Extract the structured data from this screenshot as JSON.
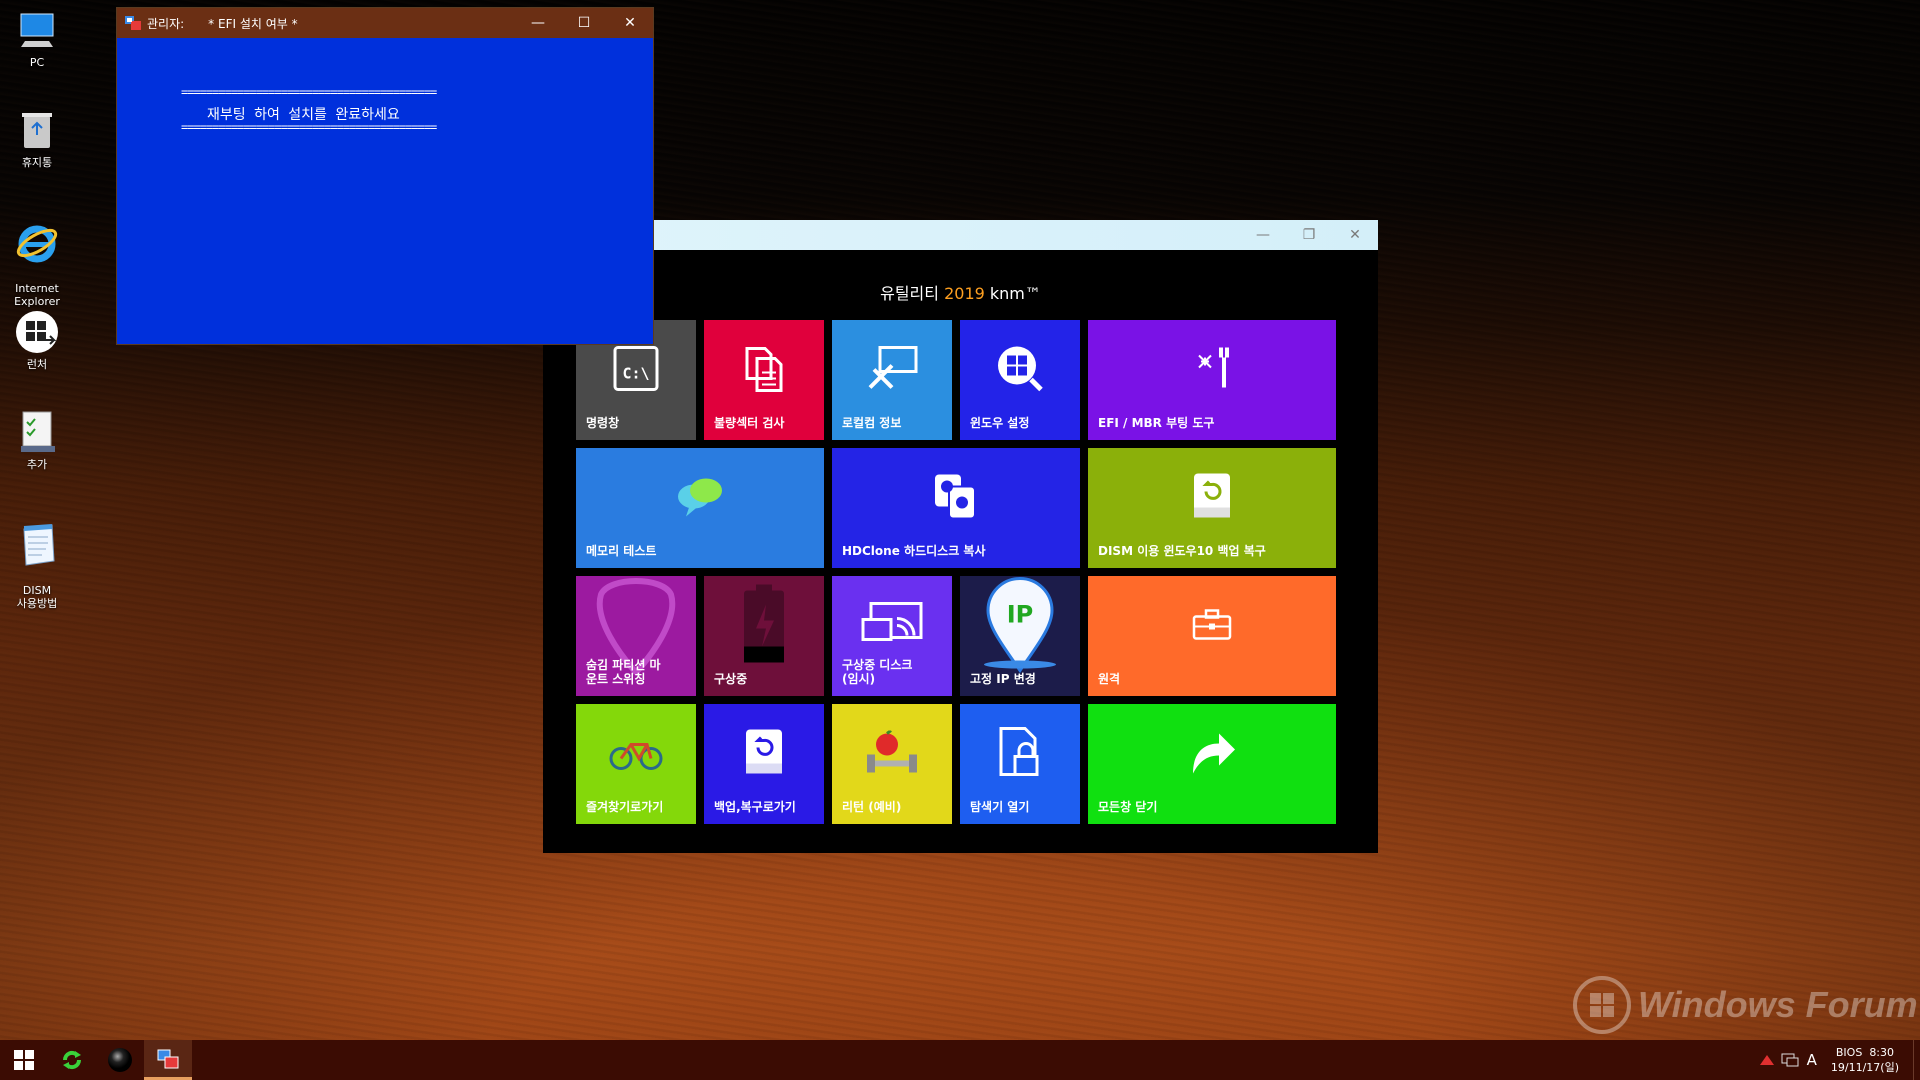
{
  "desktop": {
    "icons": [
      {
        "label": "PC",
        "icon": "computer-icon"
      },
      {
        "label": "휴지통",
        "icon": "recycle-bin-icon"
      },
      {
        "label": "Internet\nExplorer",
        "icon": "internet-explorer-icon"
      },
      {
        "label": "런처",
        "icon": "launcher-icon"
      },
      {
        "label": "추가",
        "icon": "add-checklist-icon"
      },
      {
        "label": "DISM\n사용방법",
        "icon": "notepad-icon"
      }
    ]
  },
  "console": {
    "title_prefix": "관리자:",
    "title": "* EFI 설치 여부 *",
    "separator": "=========================================",
    "message": "재부팅 하여 설치를 완료하세요",
    "controls": {
      "minimize": "—",
      "maximize": "☐",
      "close": "✕"
    }
  },
  "utility": {
    "title_main": "유틸리티 ",
    "title_year": "2019",
    "title_brand": " knm™",
    "controls": {
      "minimize": "—",
      "restore": "❐",
      "close": "✕"
    },
    "tiles": [
      {
        "label": "명령창",
        "color": "#4a4a4a",
        "icon": "command-prompt-icon"
      },
      {
        "label": "불량섹터 검사",
        "color": "#e0003c",
        "icon": "documents-icon"
      },
      {
        "label": "로컬컴 정보",
        "color": "#2b8fe0",
        "icon": "tools-monitor-icon"
      },
      {
        "label": "윈도우 설정",
        "color": "#2323e8",
        "icon": "windows-search-icon"
      },
      {
        "label": "EFI / MBR 부팅 도구",
        "color": "#7a12e6",
        "icon": "wrench-sparkle-icon"
      },
      {
        "label": "메모리 테스트",
        "color": "#2a7ce0",
        "icon": "chat-bubbles-icon"
      },
      {
        "label": "HDClone 하드디스크 복사",
        "color": "#2424e6",
        "icon": "disk-clone-icon"
      },
      {
        "label": "DISM 이용 윈도우10 백업 복구",
        "color": "#8bb00a",
        "icon": "drive-restore-icon"
      },
      {
        "label": "숨김 파티션 마\n운트 스위칭",
        "color": "#9c1aa0",
        "icon": "guitar-pick-icon"
      },
      {
        "label": "구상중",
        "color": "#6e0f3a",
        "icon": "battery-icon"
      },
      {
        "label": "구상중 디스크\n(임시)",
        "color": "#6a30f0",
        "icon": "cast-screen-icon"
      },
      {
        "label": "고정 IP 변경",
        "color": "#1c1c4a",
        "icon": "ip-pin-icon"
      },
      {
        "label": "원격",
        "color": "#ff6a2a",
        "icon": "briefcase-icon"
      },
      {
        "label": "즐겨찾기로가기",
        "color": "#84d80a",
        "icon": "bicycle-icon"
      },
      {
        "label": "백업,복구로가기",
        "color": "#2a1ae6",
        "icon": "drive-backup-icon"
      },
      {
        "label": "리턴 (예비)",
        "color": "#e2d81a",
        "icon": "apple-dumbbell-icon"
      },
      {
        "label": "탐색기 열기",
        "color": "#1e5ef0",
        "icon": "file-lock-icon"
      },
      {
        "label": "모든창 닫기",
        "color": "#10e010",
        "icon": "share-arrow-icon"
      }
    ]
  },
  "watermark": {
    "text": "Windows Forum"
  },
  "taskbar": {
    "buttons": [
      {
        "icon": "windows-start-icon"
      },
      {
        "icon": "refresh-icon"
      },
      {
        "icon": "sphere-icon"
      },
      {
        "icon": "console-app-icon",
        "active": true
      }
    ],
    "tray": {
      "ime": "A",
      "bios": "BIOS",
      "time": "8:30",
      "date": "19/11/17(일)"
    }
  }
}
